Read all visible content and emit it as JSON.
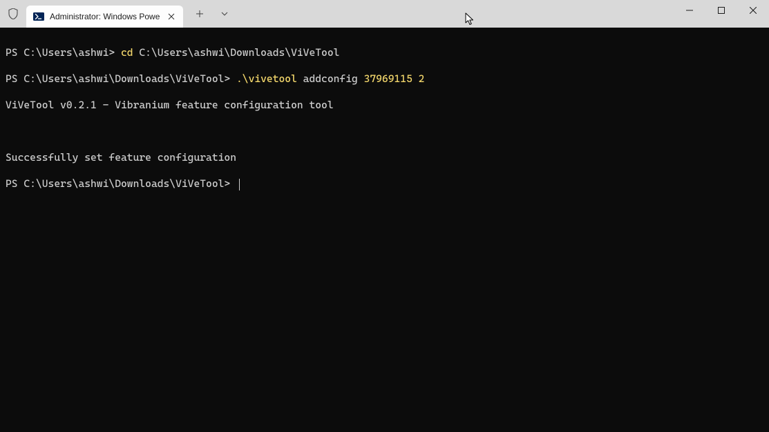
{
  "window": {
    "tab_title": "Administrator: Windows Powe",
    "icons": {
      "shield": "shield-icon",
      "powershell": "powershell-icon",
      "close_tab": "close-icon",
      "new_tab": "plus-icon",
      "dropdown": "chevron-down-icon",
      "minimize": "minimize-icon",
      "maximize": "maximize-icon",
      "close_window": "close-icon"
    }
  },
  "terminal": {
    "line1_prompt": "PS C:\\Users\\ashwi> ",
    "line1_cmd": "cd",
    "line1_arg": " C:\\Users\\ashwi\\Downloads\\ViVeTool",
    "line2_prompt": "PS C:\\Users\\ashwi\\Downloads\\ViVeTool> ",
    "line2_cmd": ".\\vivetool",
    "line2_mid": " addconfig ",
    "line2_args": "37969115 2",
    "line3": "ViVeTool v0.2.1 - Vibranium feature configuration tool",
    "blank": "",
    "line4": "Successfully set feature configuration",
    "line5_prompt": "PS C:\\Users\\ashwi\\Downloads\\ViVeTool> "
  }
}
